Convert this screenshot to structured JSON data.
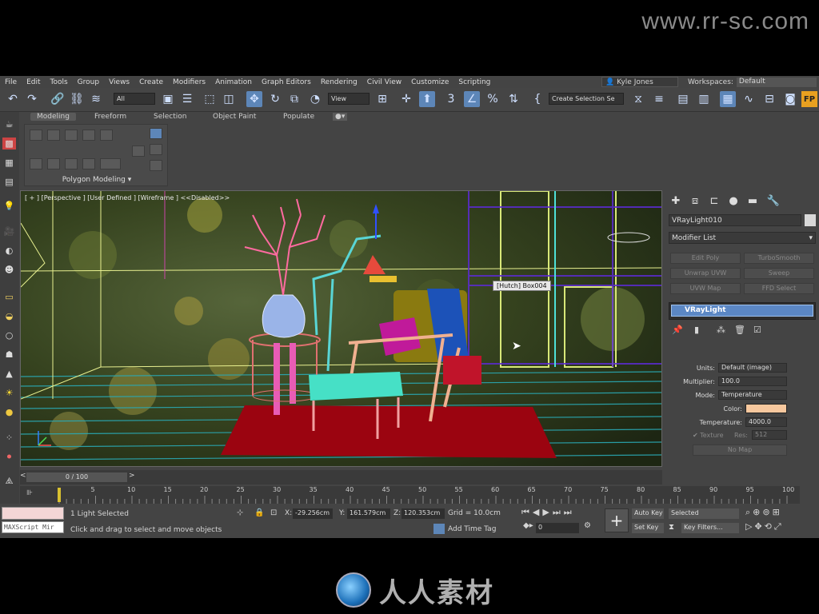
{
  "watermark": {
    "url": "www.rr-sc.com",
    "logo_text": "人人素材"
  },
  "menubar": {
    "items": [
      "File",
      "Edit",
      "Tools",
      "Group",
      "Views",
      "Create",
      "Modifiers",
      "Animation",
      "Graph Editors",
      "Rendering",
      "Civil View",
      "Customize",
      "Scripting"
    ],
    "user": "Kyle Jones",
    "workspace_label": "Workspaces:",
    "workspace_value": "Default"
  },
  "toolbar": {
    "filter_value": "All",
    "refcoord_value": "View",
    "selection_set_placeholder": "Create Selection Se"
  },
  "ribbon": {
    "tabs": [
      "Modeling",
      "Freeform",
      "Selection",
      "Object Paint",
      "Populate"
    ],
    "panel_label": "Polygon Modeling ▾"
  },
  "viewport": {
    "label": "[ + ] [Perspective ] [User Defined ] [Wireframe ]  <<Disabled>>",
    "tooltip": "[Hutch] Box004"
  },
  "command_panel": {
    "object_name": "VRayLight010",
    "modifier_list": "Modifier List",
    "modifier_buttons": [
      "Edit Poly",
      "TurboSmooth",
      "Unwrap UVW",
      "Sweep",
      "UVW Map",
      "FFD Select"
    ],
    "stack_item": "VRayLight",
    "params": {
      "units_label": "Units:",
      "units_value": "Default (image)",
      "multiplier_label": "Multiplier:",
      "multiplier_value": "100.0",
      "mode_label": "Mode:",
      "mode_value": "Temperature",
      "color_label": "Color:",
      "color_swatch": "#f7c89e",
      "temperature_label": "Temperature:",
      "temperature_value": "4000.0",
      "texture_label": "Texture",
      "res_label": "Res:",
      "res_value": "512",
      "no_map": "No Map"
    }
  },
  "timeline": {
    "frame_display": "0 / 100",
    "ticks": [
      "5",
      "10",
      "15",
      "20",
      "25",
      "30",
      "35",
      "40",
      "45",
      "50",
      "55",
      "60",
      "65",
      "70",
      "75",
      "80",
      "85",
      "90",
      "95",
      "100"
    ]
  },
  "status": {
    "maxscript": "MAXScript Mir",
    "selection": "1 Light Selected",
    "prompt": "Click and drag to select and move objects",
    "x_label": "X:",
    "x_value": "-29.256cm",
    "y_label": "Y:",
    "y_value": "161.579cm",
    "z_label": "Z:",
    "z_value": "120.353cm",
    "grid": "Grid = 10.0cm",
    "add_time_tag": "Add Time Tag",
    "auto_key": "Auto Key",
    "set_key": "Set Key",
    "key_mode": "Selected",
    "key_filters": "Key Filters...",
    "frame_field": "0"
  }
}
